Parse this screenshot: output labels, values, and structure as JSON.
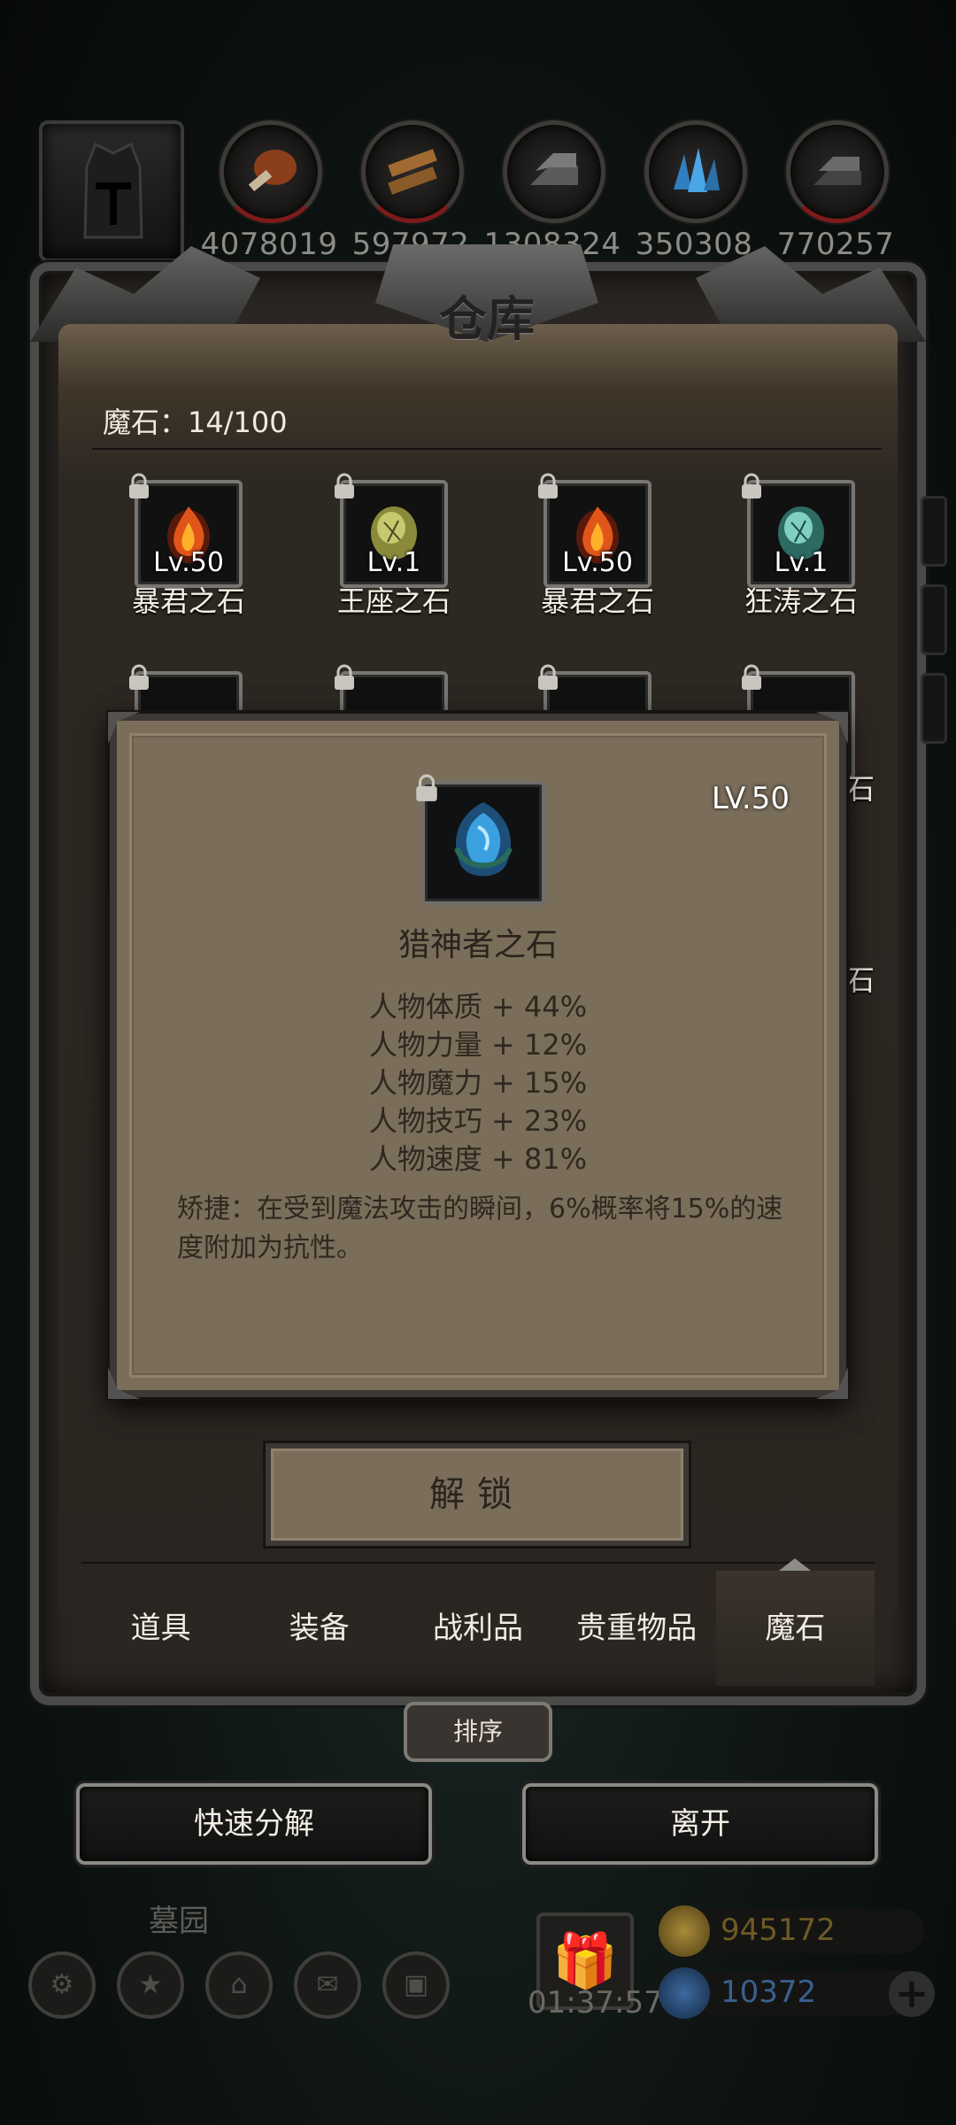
{
  "resources": [
    {
      "icon": "meat-icon",
      "value": "4078019",
      "color": "#9a4b22"
    },
    {
      "icon": "wood-icon",
      "value": "597972",
      "color": "#a06a32"
    },
    {
      "icon": "stone-icon",
      "value": "1308324",
      "color": "#7a7a78"
    },
    {
      "icon": "crystal-icon",
      "value": "350308",
      "color": "#3a8fd0"
    },
    {
      "icon": "iron-icon",
      "value": "770257",
      "color": "#6a6a68"
    }
  ],
  "warehouse": {
    "title": "仓库",
    "capacity": "魔石：14/100",
    "row1": [
      {
        "level": "Lv.50",
        "name": "暴君之石",
        "icon": "fire-stone-icon",
        "color": "#e0561a"
      },
      {
        "level": "Lv.1",
        "name": "王座之石",
        "icon": "yellow-stone-icon",
        "color": "#b8b858"
      },
      {
        "level": "Lv.50",
        "name": "暴君之石",
        "icon": "fire-stone-icon",
        "color": "#e0561a"
      },
      {
        "level": "Lv.1",
        "name": "狂涛之石",
        "icon": "teal-stone-icon",
        "color": "#5fb8a8"
      }
    ],
    "row2_partial_names": [
      "石",
      "石"
    ]
  },
  "detail": {
    "level": "LV.50",
    "name": "猎神者之石",
    "icon": "blue-stone-icon",
    "stats": [
      "人物体质 + 44%",
      "人物力量 + 12%",
      "人物魔力 + 15%",
      "人物技巧 + 23%",
      "人物速度 + 81%"
    ],
    "skill": "矫捷：在受到魔法攻击的瞬间，6%概率将15%的速度附加为抗性。"
  },
  "unlock_label": "解锁",
  "tabs": [
    {
      "label": "道具",
      "active": false
    },
    {
      "label": "装备",
      "active": false
    },
    {
      "label": "战利品",
      "active": false
    },
    {
      "label": "贵重物品",
      "active": false
    },
    {
      "label": "魔石",
      "active": true
    }
  ],
  "sort_label": "排序",
  "quick_decompose_label": "快速分解",
  "leave_label": "离开",
  "background": {
    "location": "墓园",
    "timer": "01:37:57",
    "gold": "945172",
    "gems": "10372"
  },
  "colors": {
    "parchment": "#7a6d5a",
    "frame": "#3c3935",
    "gold_text": "#6e5a26",
    "gem_text": "#3b5f8e"
  }
}
